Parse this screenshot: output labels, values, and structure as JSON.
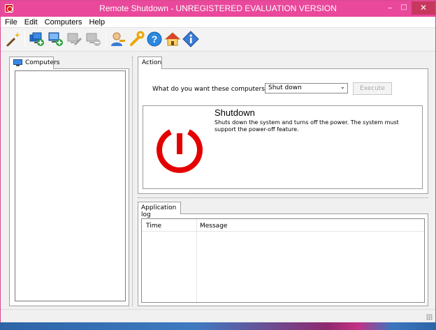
{
  "window": {
    "title": "Remote Shutdown - UNREGISTERED EVALUATION VERSION",
    "minimize_glyph": "–",
    "maximize_glyph": "□",
    "close_glyph": "✕"
  },
  "menu": {
    "items": [
      "File",
      "Edit",
      "Computers",
      "Help"
    ]
  },
  "toolbar": {
    "icons": [
      "wizard-wand-icon",
      "add-computers-icon",
      "add-computer-icon",
      "edit-computer-icon",
      "remove-computer-icon",
      "user-credentials-icon",
      "settings-wrench-icon",
      "help-icon",
      "home-icon",
      "about-info-icon"
    ]
  },
  "computers_panel": {
    "tab_label": "Computers"
  },
  "action_panel": {
    "tab_label": "Action",
    "question": "What do you want these computers to do:",
    "selected_action": "Shut down",
    "execute_label": "Execute",
    "action_title": "Shutdown",
    "action_description": "Shuts down the system and turns off the power. The system must support the power-off feature."
  },
  "log_panel": {
    "tab_label": "Application log",
    "columns": [
      "Time",
      "Message"
    ]
  },
  "colors": {
    "titlebar": "#e9489b",
    "close_button": "#c7385e",
    "power_icon": "#e40000"
  }
}
